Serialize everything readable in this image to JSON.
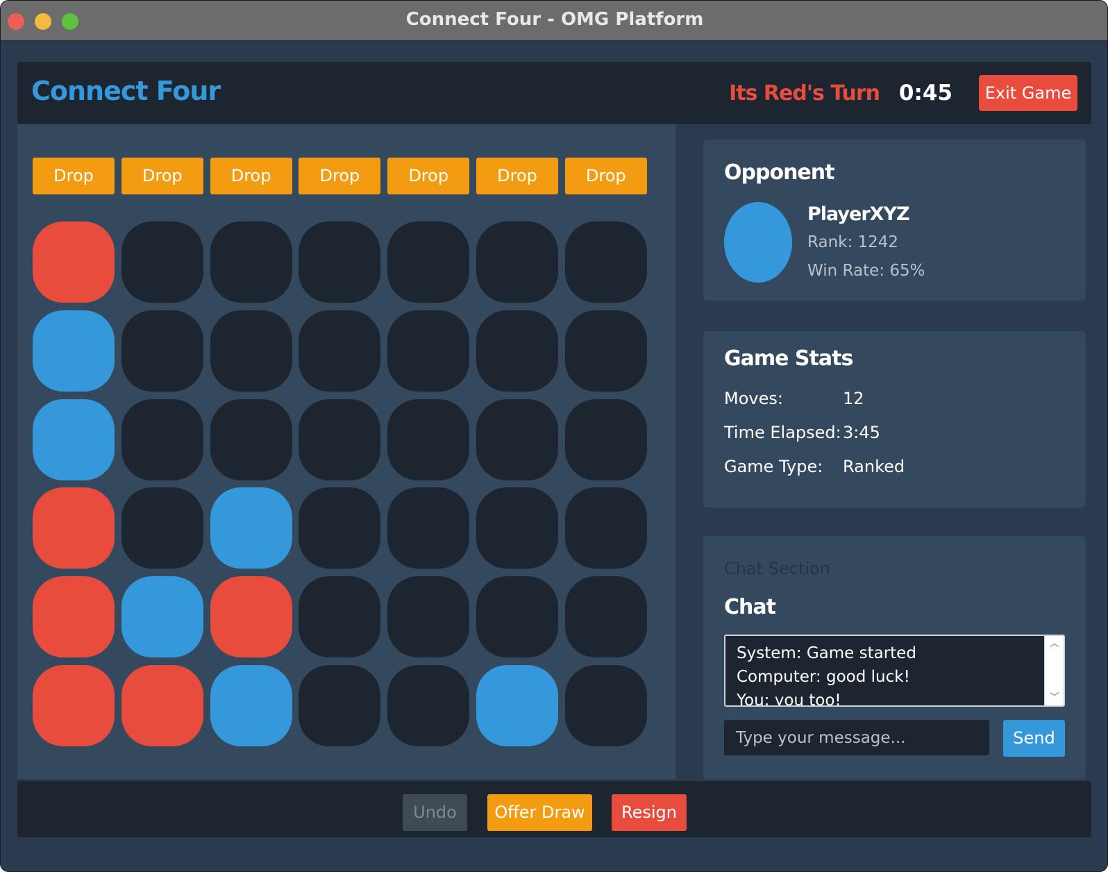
{
  "window": {
    "title": "Connect Four - OMG Platform"
  },
  "header": {
    "title": "Connect Four",
    "turn_text": "Its Red's Turn",
    "timer": "0:45",
    "exit_label": "Exit Game"
  },
  "board": {
    "drop_label": "Drop",
    "columns": 7,
    "rows": 6,
    "cells": [
      [
        "red",
        "empty",
        "empty",
        "empty",
        "empty",
        "empty",
        "empty"
      ],
      [
        "blue",
        "empty",
        "empty",
        "empty",
        "empty",
        "empty",
        "empty"
      ],
      [
        "blue",
        "empty",
        "empty",
        "empty",
        "empty",
        "empty",
        "empty"
      ],
      [
        "red",
        "empty",
        "blue",
        "empty",
        "empty",
        "empty",
        "empty"
      ],
      [
        "red",
        "blue",
        "red",
        "empty",
        "empty",
        "empty",
        "empty"
      ],
      [
        "red",
        "red",
        "blue",
        "empty",
        "empty",
        "blue",
        "empty"
      ]
    ],
    "colors": {
      "red": "#e74c3c",
      "blue": "#3498db",
      "empty": "#1d2531"
    }
  },
  "opponent": {
    "heading": "Opponent",
    "name": "PlayerXYZ",
    "rank": "Rank: 1242",
    "win_rate": "Win Rate: 65%"
  },
  "stats": {
    "heading": "Game Stats",
    "items": [
      {
        "label": "Moves:",
        "value": "12"
      },
      {
        "label": "Time Elapsed:",
        "value": "3:45"
      },
      {
        "label": "Game Type:",
        "value": "Ranked"
      }
    ]
  },
  "chat": {
    "section_label": "Chat Section",
    "heading": "Chat",
    "messages": [
      "System: Game started",
      "Computer: good luck!",
      "You: you too!"
    ],
    "input_placeholder": "Type your message...",
    "input_value": "",
    "send_label": "Send"
  },
  "footer": {
    "undo_label": "Undo",
    "offer_draw_label": "Offer Draw",
    "resign_label": "Resign"
  },
  "theme": {
    "accent": "#3498db",
    "danger": "#e74c3c",
    "warning": "#f39c12"
  }
}
